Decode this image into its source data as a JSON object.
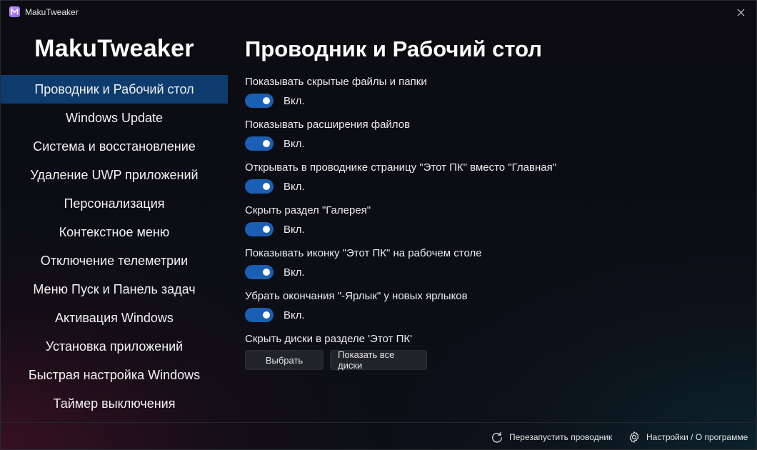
{
  "window": {
    "title": "MakuTweaker",
    "icon": "maku-app-icon",
    "close_icon": "close-icon"
  },
  "sidebar": {
    "app_title": "MakuTweaker",
    "items": [
      {
        "label": "Проводник и Рабочий стол",
        "active": true
      },
      {
        "label": "Windows Update"
      },
      {
        "label": "Система и восстановление"
      },
      {
        "label": "Удаление UWP приложений"
      },
      {
        "label": "Персонализация"
      },
      {
        "label": "Контекстное меню"
      },
      {
        "label": "Отключение телеметрии"
      },
      {
        "label": "Меню Пуск и Панель задач"
      },
      {
        "label": "Активация Windows"
      },
      {
        "label": "Установка приложений"
      },
      {
        "label": "Быстрая настройка Windows"
      },
      {
        "label": "Таймер выключения"
      }
    ]
  },
  "main": {
    "title": "Проводник и Рабочий стол",
    "settings": [
      {
        "label": "Показывать скрытые файлы и папки",
        "state": "Вкл.",
        "on": true
      },
      {
        "label": "Показывать расширения файлов",
        "state": "Вкл.",
        "on": true
      },
      {
        "label": "Открывать в проводнике страницу \"Этот ПК\" вместо \"Главная\"",
        "state": "Вкл.",
        "on": true
      },
      {
        "label": "Скрыть раздел \"Галерея\"",
        "state": "Вкл.",
        "on": true
      },
      {
        "label": "Показывать иконку \"Этот ПК\" на рабочем столе",
        "state": "Вкл.",
        "on": true
      },
      {
        "label": "Убрать окончания \"-Ярлык\" у новых ярлыков",
        "state": "Вкл.",
        "on": true
      }
    ],
    "drives": {
      "label": "Скрыть диски в разделе 'Этот ПК'",
      "select_button": "Выбрать",
      "show_all_button": "Показать все диски"
    }
  },
  "footer": {
    "restart_explorer": "Перезапустить проводник",
    "restart_icon": "refresh-icon",
    "settings_about": "Настройки / О программе",
    "settings_icon": "gear-icon"
  },
  "colors": {
    "accent": "#1a5fb4",
    "nav_active": "#0e3b6e",
    "background": "#0d0f16"
  }
}
